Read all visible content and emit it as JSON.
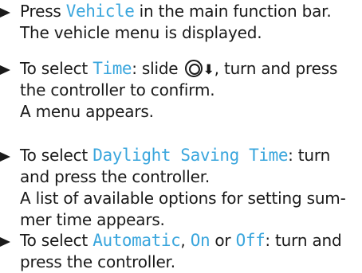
{
  "steps": [
    {
      "lines": [
        {
          "t1": "Press ",
          "kw": "Vehicle",
          "t2": " in the main function bar."
        },
        {
          "text": "The vehicle menu is displayed."
        }
      ]
    },
    {
      "lines": [
        {
          "t1": "To select ",
          "kw": "Time",
          "t2": ": slide ",
          "icon_down": "⬇",
          "t3": ", turn and press"
        },
        {
          "text": "the controller to confirm."
        },
        {
          "text": "A menu appears."
        }
      ]
    },
    {
      "lines": [
        {
          "t1": "To select ",
          "kw": "Daylight Saving Time",
          "t2": ": turn"
        },
        {
          "text": "and press the controller."
        },
        {
          "text": "A list of available options for setting sum-"
        },
        {
          "text": "mer time appears."
        }
      ]
    },
    {
      "lines": [
        {
          "t1": "To select ",
          "kw1": "Automatic",
          "t2": ", ",
          "kw2": "On",
          "t3": " or ",
          "kw3": "Off",
          "t4": ": turn and"
        },
        {
          "text": "press the controller."
        }
      ]
    }
  ],
  "icons": {
    "bullet": "triangle-bullet-icon",
    "controller": "controller-icon",
    "slide_down": "slide-down-arrow-icon"
  },
  "colors": {
    "text": "#1a1a1a",
    "keyword": "#3aa6dd",
    "background": "#ffffff"
  }
}
